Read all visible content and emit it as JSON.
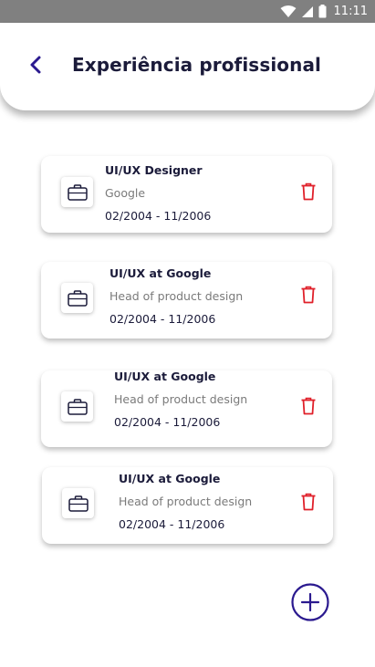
{
  "status_bar": {
    "time": "11:11"
  },
  "header": {
    "title": "Experiência profissional"
  },
  "experiences": [
    {
      "title": "UI/UX Designer",
      "company": "Google",
      "dates": "02/2004 - 11/2006"
    },
    {
      "title": "UI/UX at Google",
      "company": "Head of product design",
      "dates": "02/2004 - 11/2006"
    },
    {
      "title": "UI/UX at Google",
      "company": "Head of product design",
      "dates": "02/2004 - 11/2006"
    },
    {
      "title": "UI/UX at Google",
      "company": "Head of product design",
      "dates": "02/2004 - 11/2006"
    }
  ],
  "icons": {
    "back": "chevron-left-icon",
    "item": "briefcase-icon",
    "delete": "trash-icon",
    "add": "plus-circle-icon"
  },
  "colors": {
    "accent": "#2b1a8f",
    "delete": "#e0202a",
    "text_dark": "#1b1b3a",
    "text_muted": "#7a7a7a",
    "status_bar": "#808080"
  }
}
